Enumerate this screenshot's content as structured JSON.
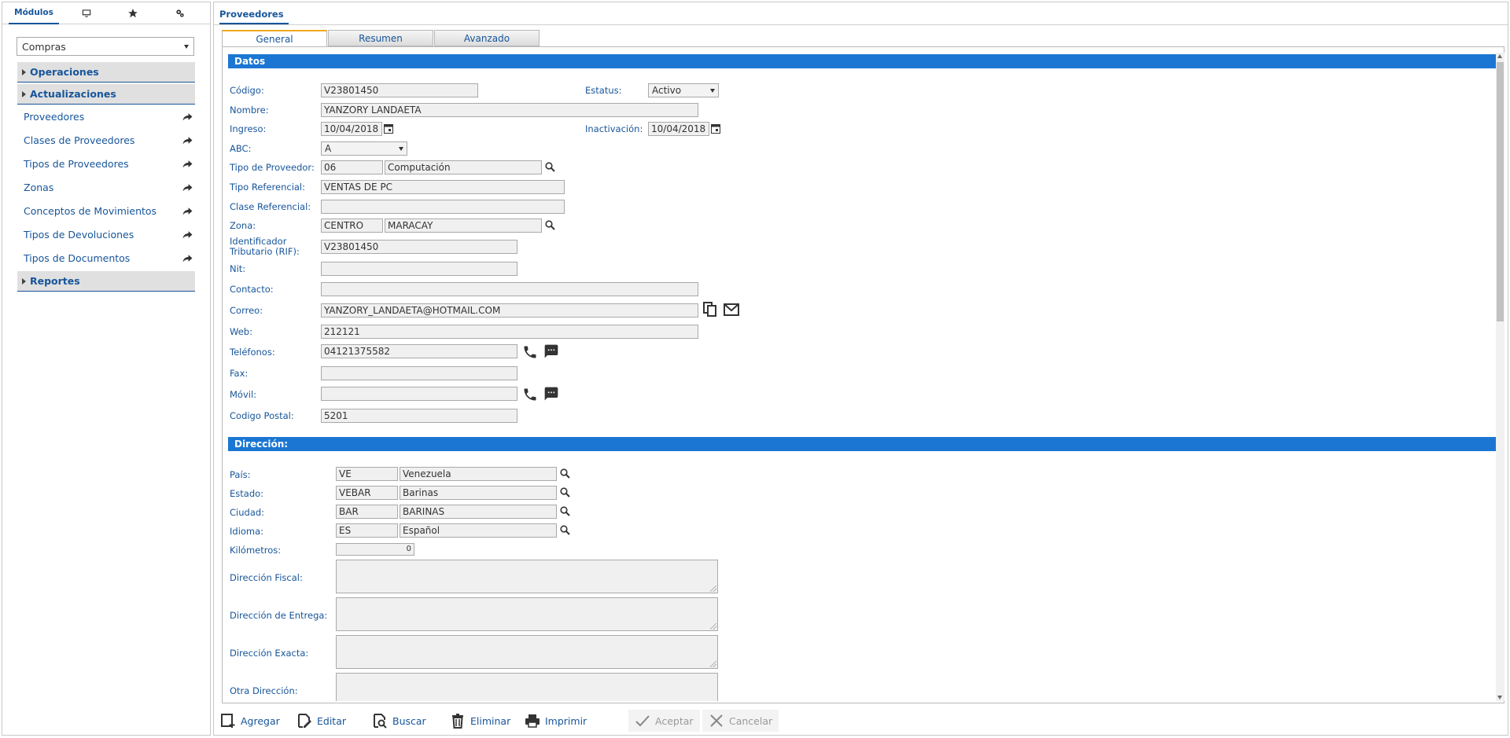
{
  "sidebar": {
    "tabs": {
      "modulos": "Módulos"
    },
    "module_select": "Compras",
    "sections": {
      "operaciones": "Operaciones",
      "actualizaciones": "Actualizaciones",
      "reportes": "Reportes"
    },
    "items": [
      {
        "label": "Proveedores"
      },
      {
        "label": "Clases de Proveedores"
      },
      {
        "label": "Tipos de Proveedores"
      },
      {
        "label": "Zonas"
      },
      {
        "label": "Conceptos de Movimientos"
      },
      {
        "label": "Tipos de Devoluciones"
      },
      {
        "label": "Tipos de Documentos"
      }
    ]
  },
  "main": {
    "tab": "Proveedores",
    "subtabs": {
      "general": "General",
      "resumen": "Resumen",
      "avanzado": "Avanzado"
    },
    "sections": {
      "datos": "Datos",
      "direccion": "Dirección:"
    }
  },
  "labels": {
    "codigo": "Código:",
    "estatus": "Estatus:",
    "nombre": "Nombre:",
    "ingreso": "Ingreso:",
    "inactivacion": "Inactivación:",
    "abc": "ABC:",
    "tipo_proveedor": "Tipo de Proveedor:",
    "tipo_referencial": "Tipo Referencial:",
    "clase_referencial": "Clase Referencial:",
    "zona": "Zona:",
    "rif_1": "Identificador",
    "rif_2": "Tributario (RIF):",
    "nit": "Nit:",
    "contacto": "Contacto:",
    "correo": "Correo:",
    "web": "Web:",
    "telefonos": "Teléfonos:",
    "fax": "Fax:",
    "movil": "Móvil:",
    "codigo_postal": "Codigo Postal:",
    "pais": "País:",
    "estado": "Estado:",
    "ciudad": "Ciudad:",
    "idioma": "Idioma:",
    "kilometros": "Kilómetros:",
    "dir_fiscal": "Dirección Fiscal:",
    "dir_entrega": "Dirección de Entrega:",
    "dir_exacta": "Dirección Exacta:",
    "otra_dir": "Otra Dirección:"
  },
  "values": {
    "codigo": "V23801450",
    "estatus": "Activo",
    "nombre": "YANZORY LANDAETA",
    "ingreso": "10/04/2018",
    "inactivacion": "10/04/2018",
    "abc": "A",
    "tipo_proveedor_code": "06",
    "tipo_proveedor_name": "Computación",
    "tipo_referencial": "VENTAS DE PC",
    "clase_referencial": "",
    "zona_code": "CENTRO",
    "zona_name": "MARACAY",
    "rif": "V23801450",
    "nit": "",
    "contacto": "",
    "correo": "YANZORY_LANDAETA@HOTMAIL.COM",
    "web": "212121",
    "telefonos": "04121375582",
    "fax": "",
    "movil": "",
    "codigo_postal": "5201",
    "pais_code": "VE",
    "pais_name": "Venezuela",
    "estado_code": "VEBAR",
    "estado_name": "Barinas",
    "ciudad_code": "BAR",
    "ciudad_name": "BARINAS",
    "idioma_code": "ES",
    "idioma_name": "Español",
    "kilometros": "0"
  },
  "toolbar": {
    "agregar": "Agregar",
    "editar": "Editar",
    "buscar": "Buscar",
    "eliminar": "Eliminar",
    "imprimir": "Imprimir",
    "aceptar": "Aceptar",
    "cancelar": "Cancelar"
  },
  "colors": {
    "accent": "#17559a",
    "section_bar": "#1b76d3",
    "active_tab": "#f0a81c"
  }
}
